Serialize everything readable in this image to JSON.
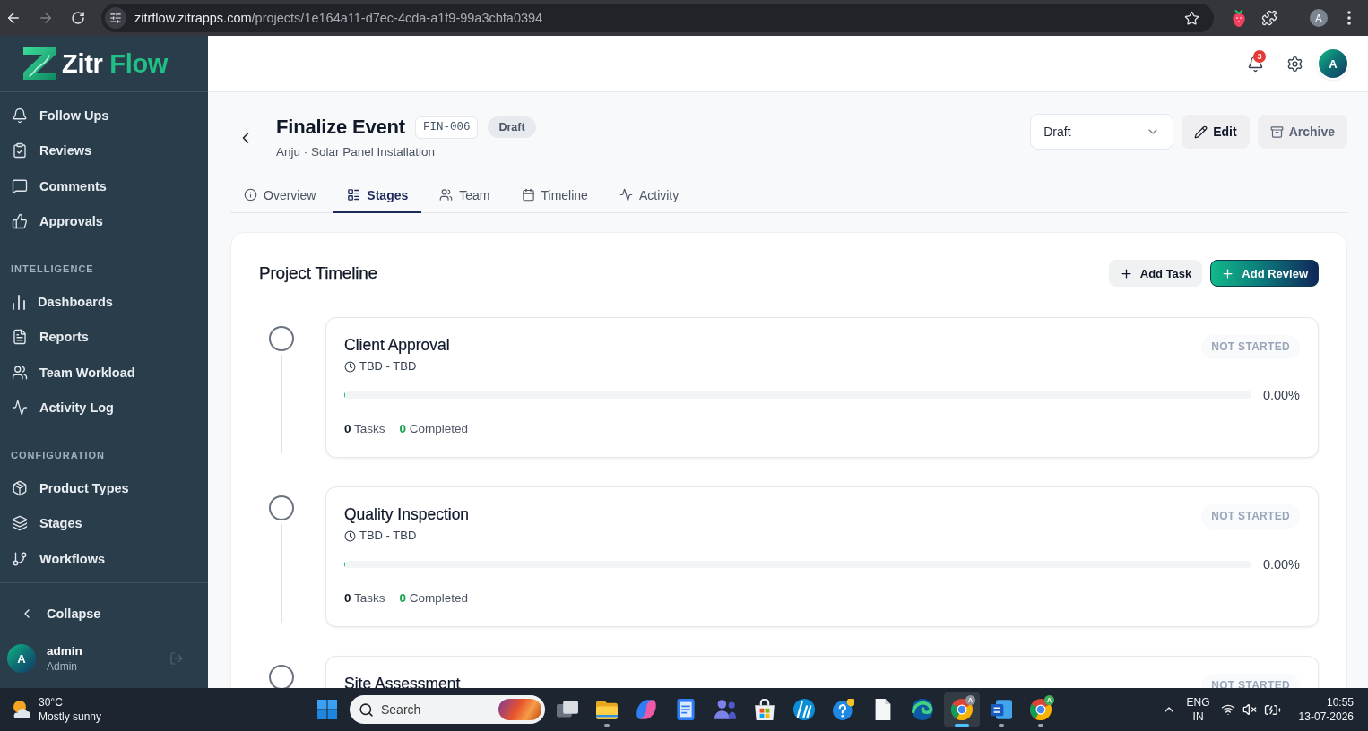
{
  "browser": {
    "back": {
      "disabled": false
    },
    "forward": {
      "disabled": true
    },
    "url": {
      "host": "zitrflow.zitrapps.com",
      "path": "/projects/1e164a11-d7ec-4cda-a1f9-99a3cbfa0394"
    },
    "profile_initial": "A"
  },
  "sidebar": {
    "logo": {
      "word_1": "Zitr",
      "word_2": "Flow"
    },
    "sections": [
      {
        "items": [
          {
            "label": "Follow Ups"
          },
          {
            "label": "Reviews"
          },
          {
            "label": "Comments"
          },
          {
            "label": "Approvals"
          }
        ]
      },
      {
        "heading": "INTELLIGENCE",
        "items": [
          {
            "label": "Dashboards"
          },
          {
            "label": "Reports"
          },
          {
            "label": "Team Workload"
          },
          {
            "label": "Activity Log"
          }
        ]
      },
      {
        "heading": "CONFIGURATION",
        "items": [
          {
            "label": "Product Types"
          },
          {
            "label": "Stages"
          },
          {
            "label": "Workflows"
          }
        ]
      }
    ],
    "collapse": {
      "label": "Collapse"
    },
    "user": {
      "initial": "A",
      "name": "admin",
      "role": "Admin"
    }
  },
  "header": {
    "notification_count": "3",
    "avatar_initial": "A"
  },
  "project": {
    "title": "Finalize Event",
    "code": "FIN-006",
    "status_badge": "Draft",
    "subtitle": "Anju · Solar Panel Installation",
    "status_select": {
      "value": "Draft"
    },
    "actions": [
      {
        "label": "Edit",
        "kind": "default"
      },
      {
        "label": "Archive",
        "kind": "muted"
      }
    ]
  },
  "tabs": [
    {
      "label": "Overview",
      "selected": false
    },
    {
      "label": "Stages",
      "selected": true
    },
    {
      "label": "Team",
      "selected": false
    },
    {
      "label": "Timeline",
      "selected": false
    },
    {
      "label": "Activity",
      "selected": false
    }
  ],
  "timeline": {
    "title": "Project Timeline",
    "actions": [
      {
        "label": "Add Task",
        "kind": "secondary"
      },
      {
        "label": "Add Review",
        "kind": "primary"
      }
    ],
    "stages": [
      {
        "name": "Client Approval",
        "dates": "TBD - TBD",
        "status": "NOT STARTED",
        "level": 0,
        "reading": "0.00%",
        "tasks": {
          "count": "0",
          "label": "Tasks"
        },
        "completed": {
          "count": "0",
          "label": "Completed"
        }
      },
      {
        "name": "Quality Inspection",
        "dates": "TBD - TBD",
        "status": "NOT STARTED",
        "level": 0,
        "reading": "0.00%",
        "tasks": {
          "count": "0",
          "label": "Tasks"
        },
        "completed": {
          "count": "0",
          "label": "Completed"
        }
      },
      {
        "name": "Site Assessment",
        "status": "NOT STARTED"
      }
    ]
  },
  "taskbar": {
    "weather": {
      "temperature": "30°C",
      "condition": "Mostly sunny"
    },
    "search": {
      "placeholder": "Search"
    },
    "apps": [
      {
        "running": false,
        "selected": false
      },
      {
        "running": true,
        "selected": false
      },
      {
        "running": false,
        "selected": false
      },
      {
        "running": false,
        "selected": false
      },
      {
        "running": false,
        "selected": false
      },
      {
        "running": false,
        "selected": false
      },
      {
        "running": false,
        "selected": false
      },
      {
        "running": false,
        "selected": false
      },
      {
        "running": false,
        "selected": false
      },
      {
        "running": false,
        "selected": false
      },
      {
        "running": true,
        "selected": true,
        "badge": {
          "label": "A",
          "color": "#8b9299"
        }
      },
      {
        "running": true,
        "selected": false
      },
      {
        "running": true,
        "selected": false,
        "badge": {
          "label": "A",
          "color": "#3fae5a"
        }
      }
    ],
    "tray": {
      "language": "ENG",
      "region": "IN",
      "time": "10:55",
      "date": "13-07-2026"
    }
  }
}
